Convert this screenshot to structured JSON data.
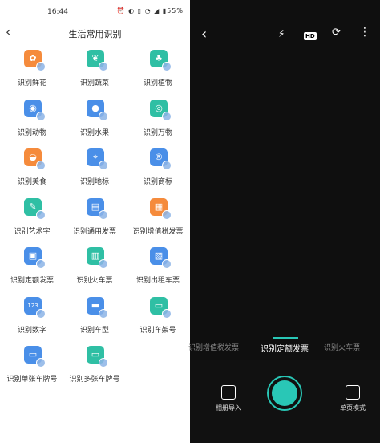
{
  "status": {
    "time": "16:44",
    "battery": "55%"
  },
  "header": {
    "back": "‹",
    "title": "生活常用识别"
  },
  "items": [
    {
      "label": "识别鲜花",
      "color": "#f58b3c",
      "glyph": "✿"
    },
    {
      "label": "识别蔬菜",
      "color": "#2fbfa4",
      "glyph": "❦"
    },
    {
      "label": "识别植物",
      "color": "#2fbfa4",
      "glyph": "♣"
    },
    {
      "label": "识别动物",
      "color": "#4a8fe8",
      "glyph": "◉"
    },
    {
      "label": "识别水果",
      "color": "#4a8fe8",
      "glyph": "●"
    },
    {
      "label": "识别万物",
      "color": "#2fbfa4",
      "glyph": "◎"
    },
    {
      "label": "识别美食",
      "color": "#f58b3c",
      "glyph": "◒"
    },
    {
      "label": "识别地标",
      "color": "#4a8fe8",
      "glyph": "⌖"
    },
    {
      "label": "识别商标",
      "color": "#4a8fe8",
      "glyph": "®"
    },
    {
      "label": "识别艺术字",
      "color": "#2fbfa4",
      "glyph": "✎"
    },
    {
      "label": "识别通用发票",
      "color": "#4a8fe8",
      "glyph": "▤"
    },
    {
      "label": "识别增值税发票",
      "color": "#f58b3c",
      "glyph": "▦"
    },
    {
      "label": "识别定额发票",
      "color": "#4a8fe8",
      "glyph": "▣"
    },
    {
      "label": "识别火车票",
      "color": "#2fbfa4",
      "glyph": "▥"
    },
    {
      "label": "识别出租车票",
      "color": "#4a8fe8",
      "glyph": "▨"
    },
    {
      "label": "识别数字",
      "color": "#4a8fe8",
      "glyph": "123"
    },
    {
      "label": "识别车型",
      "color": "#4a8fe8",
      "glyph": "▬"
    },
    {
      "label": "识别车架号",
      "color": "#2fbfa4",
      "glyph": "▭"
    },
    {
      "label": "识别单张车牌号",
      "color": "#4a8fe8",
      "glyph": "▭"
    },
    {
      "label": "识别多张车牌号",
      "color": "#2fbfa4",
      "glyph": "▭"
    }
  ],
  "camera": {
    "back": "‹",
    "flash": "⚡",
    "hd": "HD",
    "switch": "⟳",
    "more": "⋮",
    "modes": [
      "识别增值税发票",
      "识别定额发票",
      "识别火车票"
    ],
    "album_label": "相册导入",
    "single_label": "单页模式"
  }
}
